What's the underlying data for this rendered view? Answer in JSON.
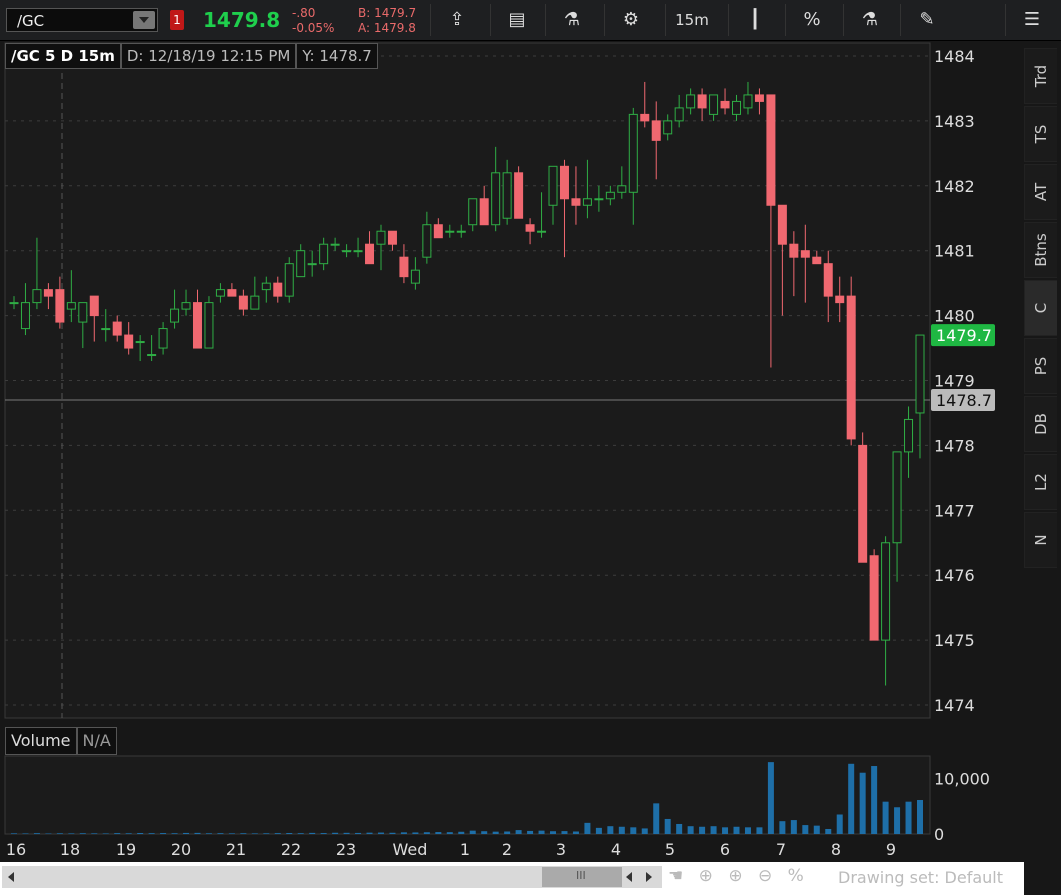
{
  "toolbar": {
    "symbol": "/GC",
    "alert_badge": "1",
    "last_price": "1479.8",
    "net_change": "-.80",
    "pct_change": "-0.05%",
    "bid": "B: 1479.7",
    "ask": "A: 1479.8",
    "timeframe": "15m",
    "percent_label": "%"
  },
  "legend": {
    "title": "/GC 5 D 15m",
    "date": "D: 12/18/19 12:15 PM",
    "y": "Y: 1478.7"
  },
  "volume_panel": {
    "label": "Volume",
    "value": "N/A"
  },
  "sidebar_tabs": [
    "Trd",
    "TS",
    "AT",
    "Btns",
    "C",
    "PS",
    "DB",
    "L2",
    "N"
  ],
  "bottom_bar": {
    "drawing_set": "Drawing set: Default",
    "scroll_mid": "III"
  },
  "colors": {
    "up": "#2fae45",
    "down": "#f06870",
    "volume": "#1e6fa8",
    "price_tag": "#1fb843",
    "crosshair_tag": "#bbbbbb"
  },
  "chart_data": {
    "type": "candlestick",
    "xlabels": [
      "16",
      "18",
      "19",
      "20",
      "21",
      "22",
      "23",
      "Wed",
      "1",
      "2",
      "3",
      "4",
      "5",
      "6",
      "7",
      "8",
      "9"
    ],
    "ylim": [
      1473.8,
      1484.2
    ],
    "yticks": [
      "1474",
      "1475",
      "1476",
      "1477",
      "1478",
      "1479",
      "1480",
      "1481",
      "1482",
      "1483",
      "1484"
    ],
    "volume_ticks": [
      "0",
      "10,000"
    ],
    "volume_max": 14000,
    "current_price": "1479.7",
    "crosshair_price": "1478.7",
    "candles": [
      [
        1480.2,
        1480.3,
        1480.1,
        1480.2
      ],
      [
        1479.8,
        1480.5,
        1479.7,
        1480.2
      ],
      [
        1480.2,
        1481.2,
        1480.1,
        1480.4
      ],
      [
        1480.4,
        1480.5,
        1480.1,
        1480.3
      ],
      [
        1480.4,
        1480.6,
        1479.8,
        1479.9
      ],
      [
        1480.1,
        1480.7,
        1479.9,
        1480.2
      ],
      [
        1479.9,
        1480.2,
        1479.5,
        1480.2
      ],
      [
        1480.3,
        1480.3,
        1479.6,
        1480.0
      ],
      [
        1479.8,
        1480.1,
        1479.6,
        1479.8
      ],
      [
        1479.9,
        1480.0,
        1479.6,
        1479.7
      ],
      [
        1479.7,
        1479.9,
        1479.4,
        1479.5
      ],
      [
        1479.6,
        1479.7,
        1479.3,
        1479.6
      ],
      [
        1479.4,
        1479.7,
        1479.3,
        1479.4
      ],
      [
        1479.5,
        1479.9,
        1479.4,
        1479.8
      ],
      [
        1479.9,
        1480.4,
        1479.8,
        1480.1
      ],
      [
        1480.1,
        1480.4,
        1480.0,
        1480.2
      ],
      [
        1480.2,
        1480.4,
        1479.5,
        1479.5
      ],
      [
        1479.5,
        1480.3,
        1479.5,
        1480.2
      ],
      [
        1480.3,
        1480.5,
        1480.2,
        1480.4
      ],
      [
        1480.4,
        1480.5,
        1480.3,
        1480.3
      ],
      [
        1480.3,
        1480.4,
        1480.0,
        1480.1
      ],
      [
        1480.1,
        1480.6,
        1480.1,
        1480.3
      ],
      [
        1480.4,
        1480.6,
        1480.2,
        1480.5
      ],
      [
        1480.5,
        1480.6,
        1480.2,
        1480.3
      ],
      [
        1480.3,
        1480.9,
        1480.2,
        1480.8
      ],
      [
        1480.6,
        1481.1,
        1480.6,
        1481.0
      ],
      [
        1480.8,
        1481.0,
        1480.6,
        1480.8
      ],
      [
        1480.8,
        1481.2,
        1480.7,
        1481.1
      ],
      [
        1481.1,
        1481.2,
        1481.0,
        1481.1
      ],
      [
        1481.0,
        1481.1,
        1480.9,
        1481.0
      ],
      [
        1481.0,
        1481.2,
        1480.9,
        1481.0
      ],
      [
        1481.1,
        1481.3,
        1480.9,
        1480.8
      ],
      [
        1481.1,
        1481.4,
        1480.7,
        1481.3
      ],
      [
        1481.3,
        1481.3,
        1481.0,
        1481.1
      ],
      [
        1480.9,
        1481.1,
        1480.5,
        1480.6
      ],
      [
        1480.5,
        1480.9,
        1480.4,
        1480.7
      ],
      [
        1480.9,
        1481.6,
        1480.8,
        1481.4
      ],
      [
        1481.4,
        1481.5,
        1481.2,
        1481.2
      ],
      [
        1481.3,
        1481.4,
        1481.2,
        1481.3
      ],
      [
        1481.3,
        1481.4,
        1481.2,
        1481.3
      ],
      [
        1481.4,
        1481.8,
        1481.3,
        1481.8
      ],
      [
        1481.8,
        1482.0,
        1481.4,
        1481.4
      ],
      [
        1481.4,
        1482.6,
        1481.3,
        1482.2
      ],
      [
        1481.5,
        1482.4,
        1481.4,
        1482.2
      ],
      [
        1482.2,
        1482.3,
        1481.5,
        1481.5
      ],
      [
        1481.4,
        1481.5,
        1481.1,
        1481.3
      ],
      [
        1481.3,
        1481.9,
        1481.2,
        1481.3
      ],
      [
        1481.7,
        1482.3,
        1481.4,
        1482.3
      ],
      [
        1482.3,
        1482.4,
        1480.9,
        1481.8
      ],
      [
        1481.8,
        1482.3,
        1481.4,
        1481.7
      ],
      [
        1481.7,
        1482.4,
        1481.5,
        1481.8
      ],
      [
        1481.8,
        1482.0,
        1481.6,
        1481.8
      ],
      [
        1481.8,
        1482.0,
        1481.7,
        1481.9
      ],
      [
        1481.9,
        1482.3,
        1481.8,
        1482.0
      ],
      [
        1481.9,
        1483.2,
        1481.4,
        1483.1
      ],
      [
        1483.1,
        1483.6,
        1482.9,
        1483.0
      ],
      [
        1483.0,
        1483.3,
        1482.1,
        1482.7
      ],
      [
        1482.8,
        1483.1,
        1482.7,
        1483.0
      ],
      [
        1483.0,
        1483.4,
        1482.9,
        1483.2
      ],
      [
        1483.2,
        1483.5,
        1483.1,
        1483.4
      ],
      [
        1483.4,
        1483.5,
        1483.0,
        1483.2
      ],
      [
        1483.1,
        1483.4,
        1483.0,
        1483.4
      ],
      [
        1483.3,
        1483.5,
        1483.1,
        1483.2
      ],
      [
        1483.1,
        1483.4,
        1483.0,
        1483.3
      ],
      [
        1483.2,
        1483.6,
        1483.1,
        1483.4
      ],
      [
        1483.4,
        1483.5,
        1483.1,
        1483.3
      ],
      [
        1483.4,
        1483.4,
        1479.2,
        1481.7
      ],
      [
        1481.7,
        1481.7,
        1480.0,
        1481.1
      ],
      [
        1481.1,
        1481.3,
        1480.3,
        1480.9
      ],
      [
        1481.0,
        1481.4,
        1480.2,
        1480.9
      ],
      [
        1480.9,
        1481.0,
        1480.8,
        1480.8
      ],
      [
        1480.8,
        1481.0,
        1479.9,
        1480.3
      ],
      [
        1480.3,
        1480.6,
        1479.9,
        1480.2
      ],
      [
        1480.3,
        1480.6,
        1478.0,
        1478.1
      ],
      [
        1478.0,
        1478.2,
        1477.1,
        1476.2
      ],
      [
        1476.3,
        1476.4,
        1475.1,
        1475.0
      ],
      [
        1475.0,
        1476.6,
        1474.3,
        1476.5
      ],
      [
        1476.5,
        1477.9,
        1475.9,
        1477.9
      ],
      [
        1477.9,
        1478.6,
        1477.5,
        1478.4
      ],
      [
        1478.5,
        1479.2,
        1477.8,
        1479.7
      ]
    ],
    "volumes": [
      120,
      100,
      150,
      90,
      130,
      110,
      140,
      120,
      100,
      160,
      130,
      180,
      150,
      170,
      140,
      190,
      200,
      130,
      150,
      120,
      140,
      110,
      130,
      160,
      180,
      150,
      200,
      170,
      220,
      210,
      190,
      240,
      260,
      220,
      300,
      280,
      320,
      350,
      330,
      400,
      600,
      500,
      420,
      450,
      700,
      550,
      600,
      500,
      520,
      450,
      2000,
      1100,
      1400,
      1300,
      1200,
      1000,
      5500,
      2700,
      1800,
      1400,
      1300,
      1400,
      1200,
      1300,
      1200,
      1200,
      12900,
      2300,
      2500,
      1600,
      1500,
      900,
      3500,
      12600,
      11000,
      12200,
      5800,
      4800,
      5800,
      6100
    ]
  }
}
